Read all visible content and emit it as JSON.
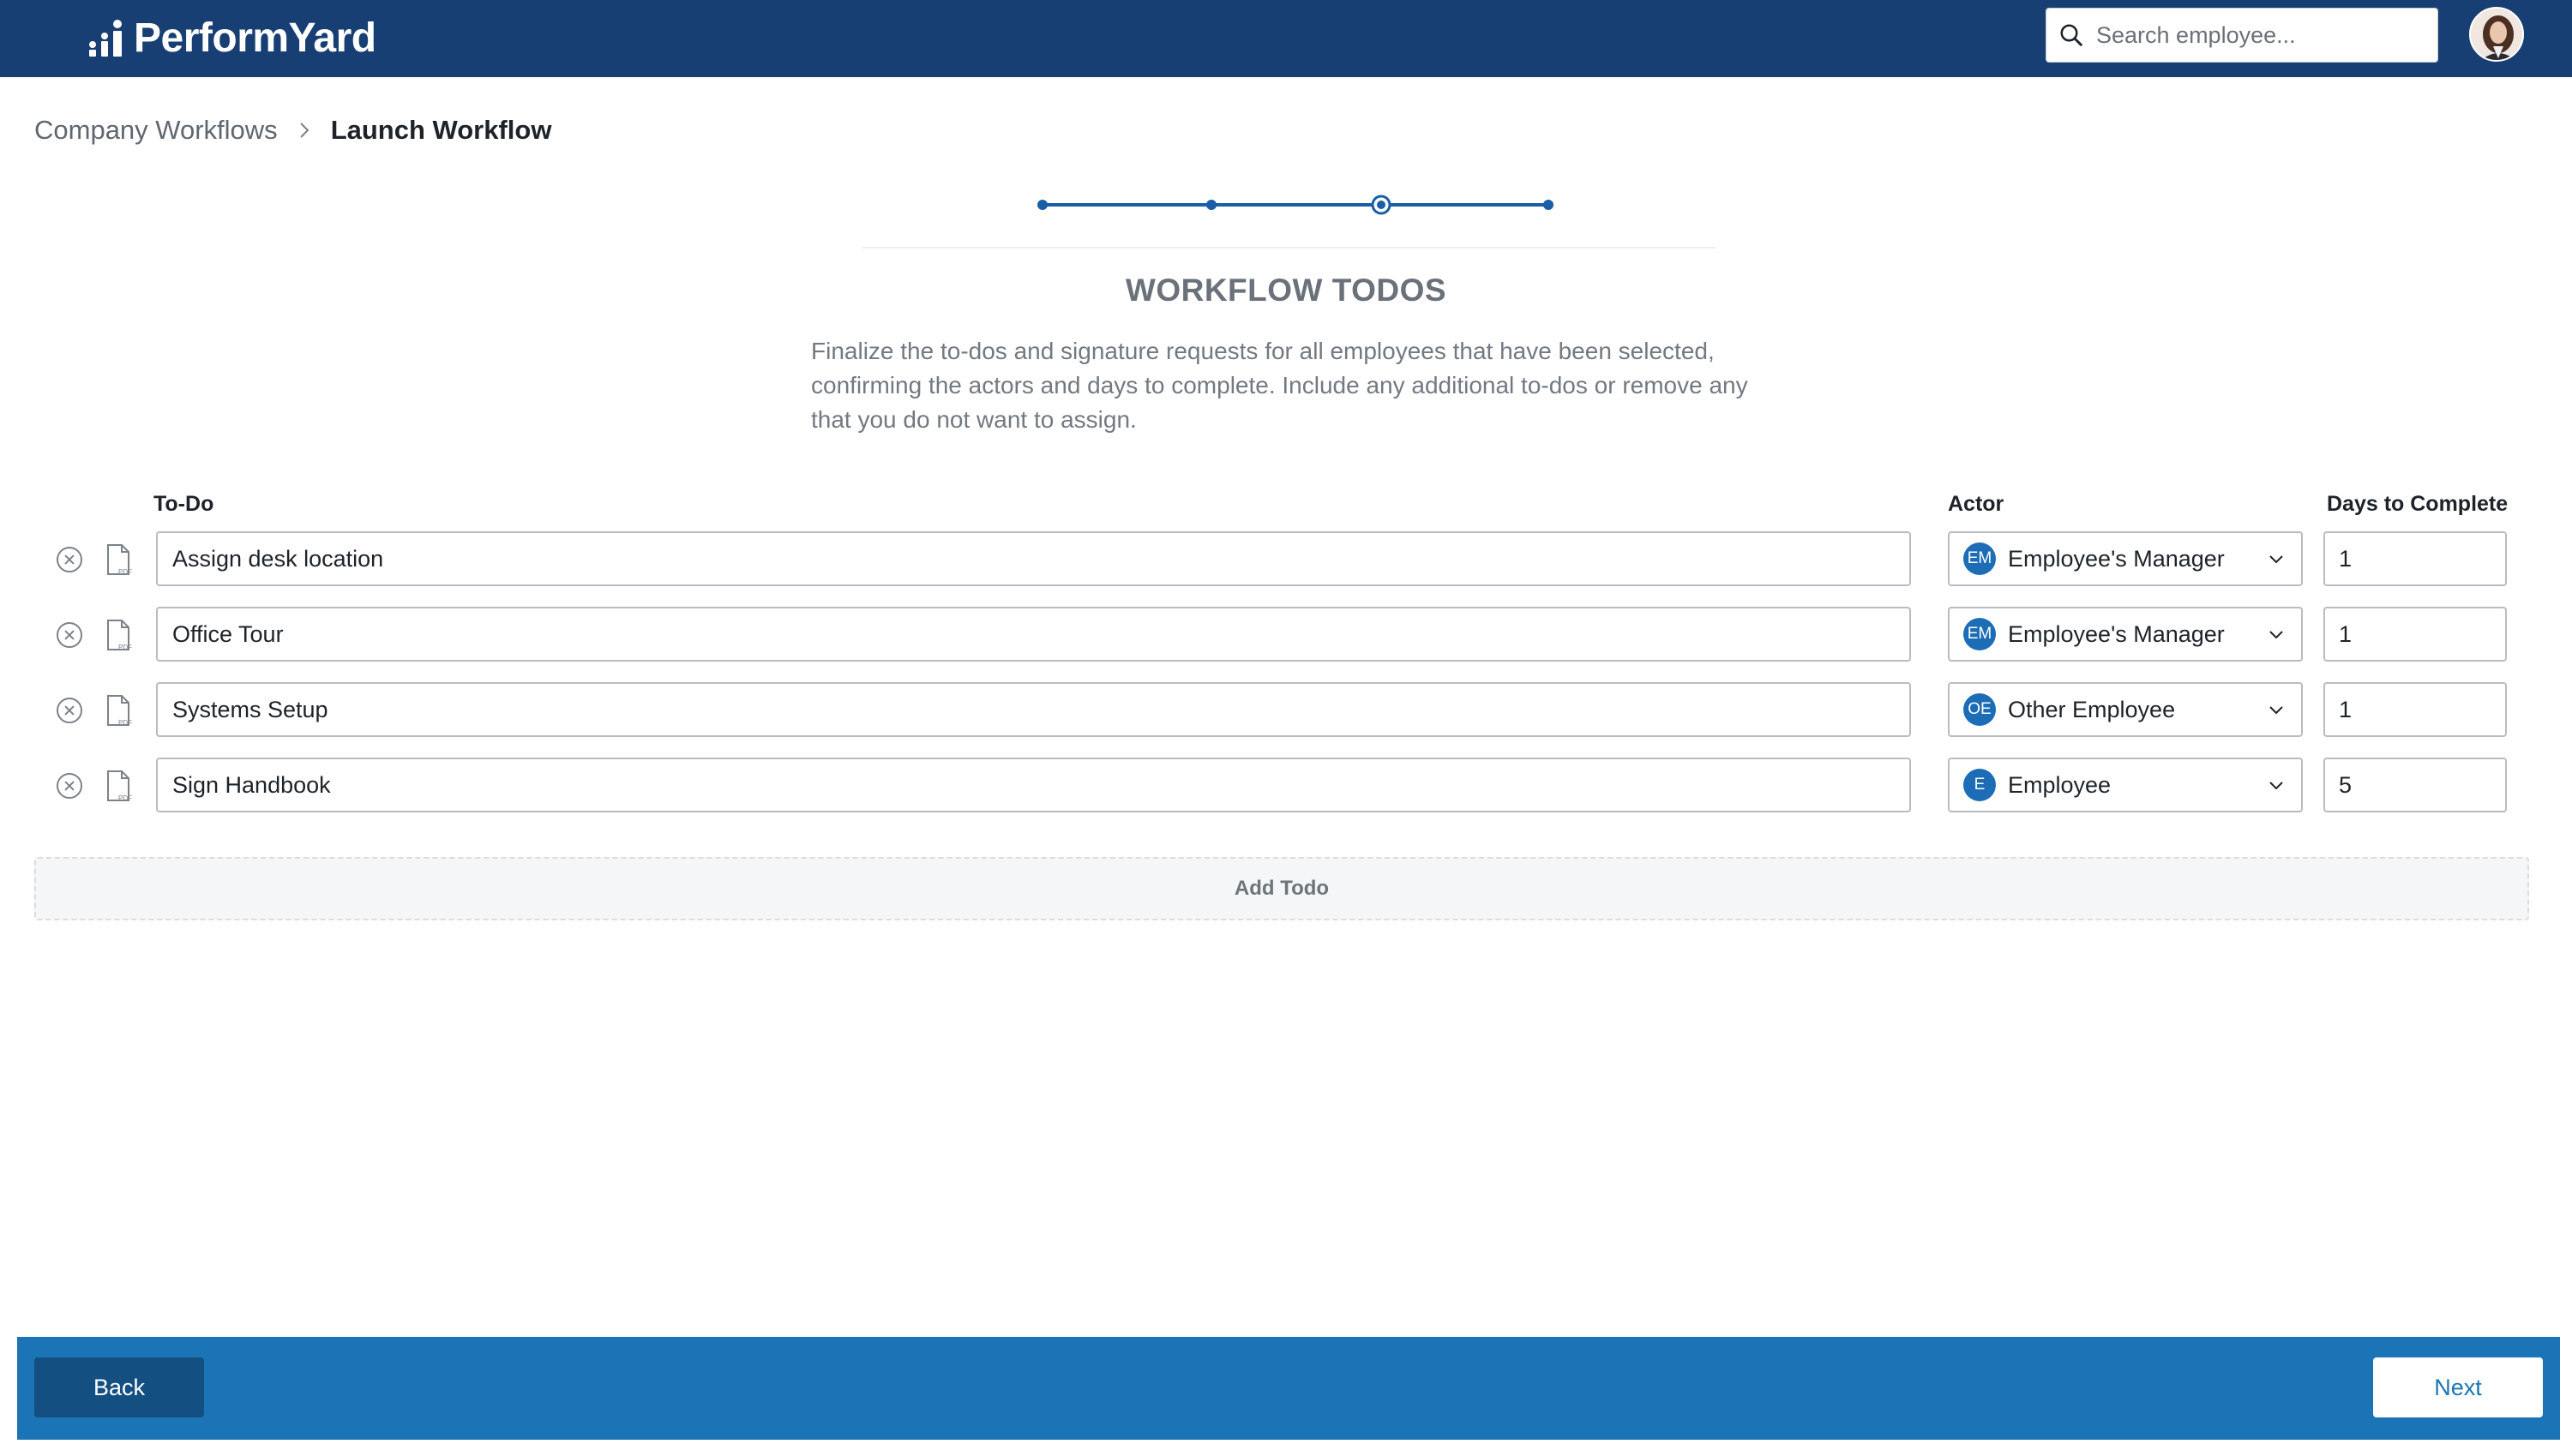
{
  "header": {
    "logo_text": "PerformYard",
    "search_placeholder": "Search employee..."
  },
  "breadcrumb": {
    "parent": "Company Workflows",
    "current": "Launch Workflow"
  },
  "stepper": {
    "total_steps": 4,
    "current_step": 3
  },
  "page": {
    "title": "WORKFLOW TODOS",
    "description": "Finalize the to-dos and signature requests for all employees that have been selected, confirming the actors and days to complete. Include any additional to-dos or remove any that you do not want to assign."
  },
  "columns": {
    "todo": "To-Do",
    "actor": "Actor",
    "days": "Days to Complete"
  },
  "todos": [
    {
      "name": "Assign desk location",
      "actor_badge": "EM",
      "actor": "Employee's Manager",
      "days": "1"
    },
    {
      "name": "Office Tour",
      "actor_badge": "EM",
      "actor": "Employee's Manager",
      "days": "1"
    },
    {
      "name": "Systems Setup",
      "actor_badge": "OE",
      "actor": "Other Employee",
      "days": "1"
    },
    {
      "name": "Sign Handbook",
      "actor_badge": "E",
      "actor": "Employee",
      "days": "5"
    }
  ],
  "add_todo_label": "Add Todo",
  "footer": {
    "back_label": "Back",
    "next_label": "Next"
  },
  "colors": {
    "header_bg": "#173f73",
    "accent": "#1a74b5",
    "back_button": "#144f81",
    "badge": "#1c6db6"
  }
}
